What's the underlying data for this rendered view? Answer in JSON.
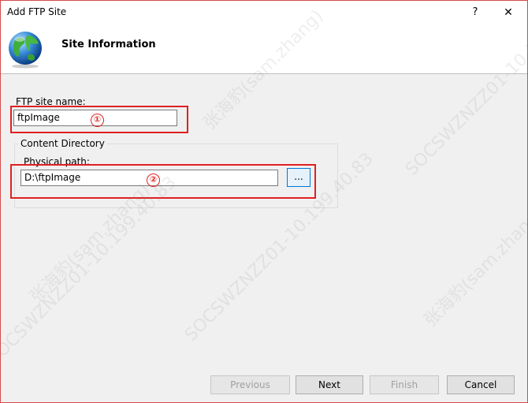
{
  "window": {
    "title": "Add FTP Site",
    "help_glyph": "?",
    "close_glyph": "✕"
  },
  "header": {
    "title": "Site Information",
    "icon": "globe-icon"
  },
  "form": {
    "site_name_label": "FTP site name:",
    "site_name_value": "ftpImage",
    "content_directory_label": "Content Directory",
    "physical_path_label": "Physical path:",
    "physical_path_value": "D:\\ftpImage",
    "browse_label": "..."
  },
  "annotations": {
    "marker_1": "①",
    "marker_2": "②",
    "color": "#e02020"
  },
  "footer": {
    "previous_label": "Previous",
    "next_label": "Next",
    "finish_label": "Finish",
    "cancel_label": "Cancel"
  },
  "watermark": {
    "line_1": "张海豹(sam.zhang)",
    "line_2": "SOCSWZNZZ01-10.199.40.83"
  }
}
